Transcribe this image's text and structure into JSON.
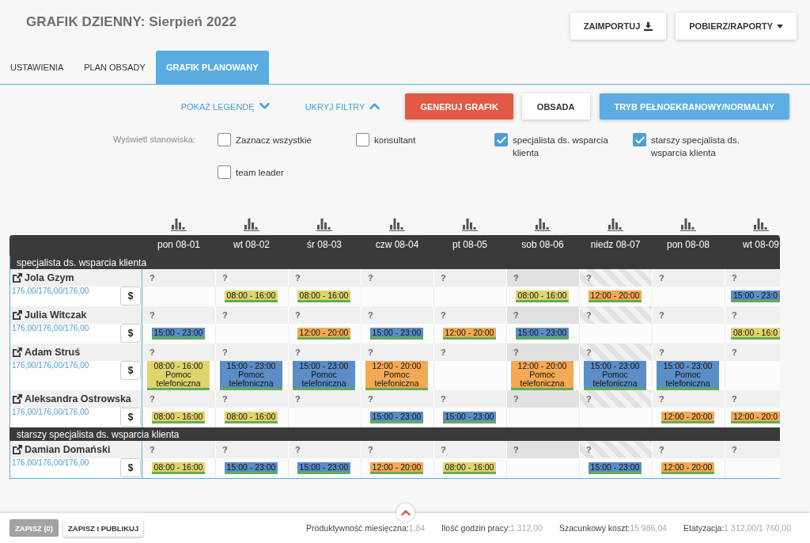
{
  "header": {
    "title": "GRAFIK DZIENNY: Sierpień 2022",
    "buttons": [
      {
        "label": "ZAIMPORTUJ",
        "kind": "import"
      },
      {
        "label": "POBIERZ/RAPORTY",
        "kind": "dropdown"
      }
    ]
  },
  "tabs": [
    {
      "label": "USTAWIENIA",
      "selected": false
    },
    {
      "label": "PLAN OBSADY",
      "selected": false
    },
    {
      "label": "GRAFIK PLANOWANY",
      "selected": true
    }
  ],
  "toolbar": {
    "toggles": [
      {
        "label": "POKAŻ LEGENDĘ",
        "expanded": false
      },
      {
        "label": "UKRYJ FILTRY",
        "expanded": true
      }
    ],
    "buttons": [
      {
        "label": "GENERUJ GRAFIK",
        "kind": "danger"
      },
      {
        "label": "OBSADA",
        "kind": "default"
      },
      {
        "label": "TRYB PEŁNOEKRANOWY/NORMALNY",
        "kind": "primary"
      }
    ]
  },
  "filters": {
    "label": "Wyświetl stanowiska:",
    "options": [
      {
        "label": "Zaznacz wszystkie",
        "checked": false
      },
      {
        "label": "konsultant",
        "checked": false
      },
      {
        "label": "specjalista ds. wsparcia klienta",
        "checked": true
      },
      {
        "label": "starszy specjalista ds. wsparcia klienta",
        "checked": true
      },
      {
        "label": "team leader",
        "checked": false
      }
    ]
  },
  "schedule": {
    "days": [
      {
        "label": "pon 08-01",
        "kind": "weekday"
      },
      {
        "label": "wt 08-02",
        "kind": "weekday"
      },
      {
        "label": "śr 08-03",
        "kind": "weekday"
      },
      {
        "label": "czw 08-04",
        "kind": "weekday"
      },
      {
        "label": "pt 08-05",
        "kind": "weekday"
      },
      {
        "label": "sob 08-06",
        "kind": "saturday"
      },
      {
        "label": "niedz 08-07",
        "kind": "sunday"
      },
      {
        "label": "pon 08-08",
        "kind": "weekday"
      },
      {
        "label": "wt 08-09",
        "kind": "weekday"
      }
    ],
    "groups": [
      {
        "title": "specjalista ds. wsparcia klienta",
        "employees": [
          {
            "name": "Jola Gzym",
            "hours": "176,00/176,00/176,00",
            "pay_button": "$",
            "cells": [
              {
                "mark": "?"
              },
              {
                "mark": "?",
                "shift": {
                  "time": "08:00 - 16:00",
                  "color": "#e0d46c"
                }
              },
              {
                "mark": "?",
                "shift": {
                  "time": "08:00 - 16:00",
                  "color": "#e0d46c"
                }
              },
              {
                "mark": "?"
              },
              {
                "mark": "?"
              },
              {
                "mark": "?",
                "shift": {
                  "time": "08:00 - 16:00",
                  "color": "#e0d46c"
                }
              },
              {
                "mark": "?",
                "shift": {
                  "time": "12:00 - 20:00",
                  "color": "#f4a952"
                }
              },
              {
                "mark": "?"
              },
              {
                "mark": "?",
                "shift": {
                  "time": "15:00 - 23:0",
                  "color": "#5b8dc6"
                }
              }
            ]
          },
          {
            "name": "Julia Witczak",
            "hours": "176,00/176,00/176,00",
            "pay_button": "$",
            "cells": [
              {
                "mark": "?",
                "shift": {
                  "time": "15:00 - 23:00",
                  "color": "#5b8dc6"
                }
              },
              {
                "mark": "?"
              },
              {
                "mark": "?",
                "shift": {
                  "time": "12:00 - 20:00",
                  "color": "#f4a952"
                }
              },
              {
                "mark": "?",
                "shift": {
                  "time": "15:00 - 23:00",
                  "color": "#5b8dc6"
                }
              },
              {
                "mark": "?",
                "shift": {
                  "time": "12:00 - 20:00",
                  "color": "#f4a952"
                }
              },
              {
                "mark": "?",
                "shift": {
                  "time": "15:00 - 23:00",
                  "color": "#5b8dc6"
                }
              },
              {
                "mark": "?"
              },
              {
                "mark": "?"
              },
              {
                "mark": "?",
                "shift": {
                  "time": "08:00 - 16:0",
                  "color": "#e0d46c"
                }
              }
            ]
          },
          {
            "name": "Adam Struś",
            "hours": "176,00/176,00/176,00",
            "pay_button": "$",
            "cells": [
              {
                "mark": "?",
                "shift": {
                  "time": "08:00 - 16:00",
                  "note": "Pomoc telefoniczna",
                  "color": "#e0d46c"
                }
              },
              {
                "mark": "?",
                "shift": {
                  "time": "15:00 - 23:00",
                  "note": "Pomoc telefoniczna",
                  "color": "#5b8dc6"
                }
              },
              {
                "mark": "?",
                "shift": {
                  "time": "15:00 - 23:00",
                  "note": "Pomoc telefoniczna",
                  "color": "#5b8dc6"
                }
              },
              {
                "mark": "?",
                "shift": {
                  "time": "12:00 - 20:00",
                  "note": "Pomoc telefoniczna",
                  "color": "#f4a952"
                }
              },
              {
                "mark": "?"
              },
              {
                "mark": "?",
                "shift": {
                  "time": "12:00 - 20:00",
                  "note": "Pomoc telefoniczna",
                  "color": "#f4a952"
                }
              },
              {
                "mark": "?",
                "shift": {
                  "time": "15:00 - 23:00",
                  "note": "Pomoc telefoniczna",
                  "color": "#5b8dc6"
                }
              },
              {
                "mark": "?",
                "shift": {
                  "time": "15:00 - 23:00",
                  "note": "Pomoc telefoniczna",
                  "color": "#5b8dc6"
                }
              },
              {
                "mark": "?"
              }
            ]
          },
          {
            "name": "Aleksandra Ostrowska",
            "hours": "176,00/176,00/176,00",
            "pay_button": "$",
            "cells": [
              {
                "mark": "?",
                "shift": {
                  "time": "08:00 - 16:00",
                  "color": "#e0d46c"
                }
              },
              {
                "mark": "?",
                "shift": {
                  "time": "08:00 - 16:00",
                  "color": "#e0d46c"
                }
              },
              {
                "mark": "?"
              },
              {
                "mark": "?",
                "shift": {
                  "time": "15:00 - 23:00",
                  "color": "#5b8dc6"
                }
              },
              {
                "mark": "?",
                "shift": {
                  "time": "15:00 - 23:00",
                  "color": "#5b8dc6"
                }
              },
              {
                "mark": "?"
              },
              {
                "mark": "?"
              },
              {
                "mark": "?",
                "shift": {
                  "time": "12:00 - 20:00",
                  "color": "#f4a952"
                }
              },
              {
                "mark": "?",
                "shift": {
                  "time": "12:00 - 20:0",
                  "color": "#f4a952"
                }
              }
            ]
          }
        ]
      },
      {
        "title": "starszy specjalista ds. wsparcia klienta",
        "employees": [
          {
            "name": "Damian Domański",
            "hours": "176,00/176,00/176,00",
            "pay_button": "$",
            "cells": [
              {
                "mark": "?",
                "shift": {
                  "time": "08:00 - 16:00",
                  "color": "#e0d46c"
                }
              },
              {
                "mark": "?",
                "shift": {
                  "time": "15:00 - 23:00",
                  "color": "#5b8dc6"
                }
              },
              {
                "mark": "?",
                "shift": {
                  "time": "15:00 - 23:00",
                  "color": "#5b8dc6"
                }
              },
              {
                "mark": "?",
                "shift": {
                  "time": "12:00 - 20:00",
                  "color": "#f4a952"
                }
              },
              {
                "mark": "?",
                "shift": {
                  "time": "08:00 - 16:00",
                  "color": "#e0d46c"
                }
              },
              {
                "mark": "?"
              },
              {
                "mark": "?",
                "shift": {
                  "time": "15:00 - 23:00",
                  "color": "#5b8dc6"
                }
              },
              {
                "mark": "?",
                "shift": {
                  "time": "12:00 - 20:00",
                  "color": "#f4a952"
                }
              },
              {
                "mark": "?"
              }
            ]
          }
        ]
      }
    ]
  },
  "footer": {
    "buttons": [
      {
        "label": "ZAPISZ (0)",
        "disabled": true
      },
      {
        "label": "ZAPISZ I PUBLIKUJ",
        "disabled": false
      }
    ],
    "stats": [
      {
        "label": "Produktywność miesięczna:",
        "value": "1,84"
      },
      {
        "label": "Ilość godzin pracy:",
        "value": "1 312,00"
      },
      {
        "label": "Szacunkowy koszt:",
        "value": "15 986,04"
      },
      {
        "label": "Etatyzacja:",
        "value": "1 312,00/1 760,00"
      }
    ]
  }
}
